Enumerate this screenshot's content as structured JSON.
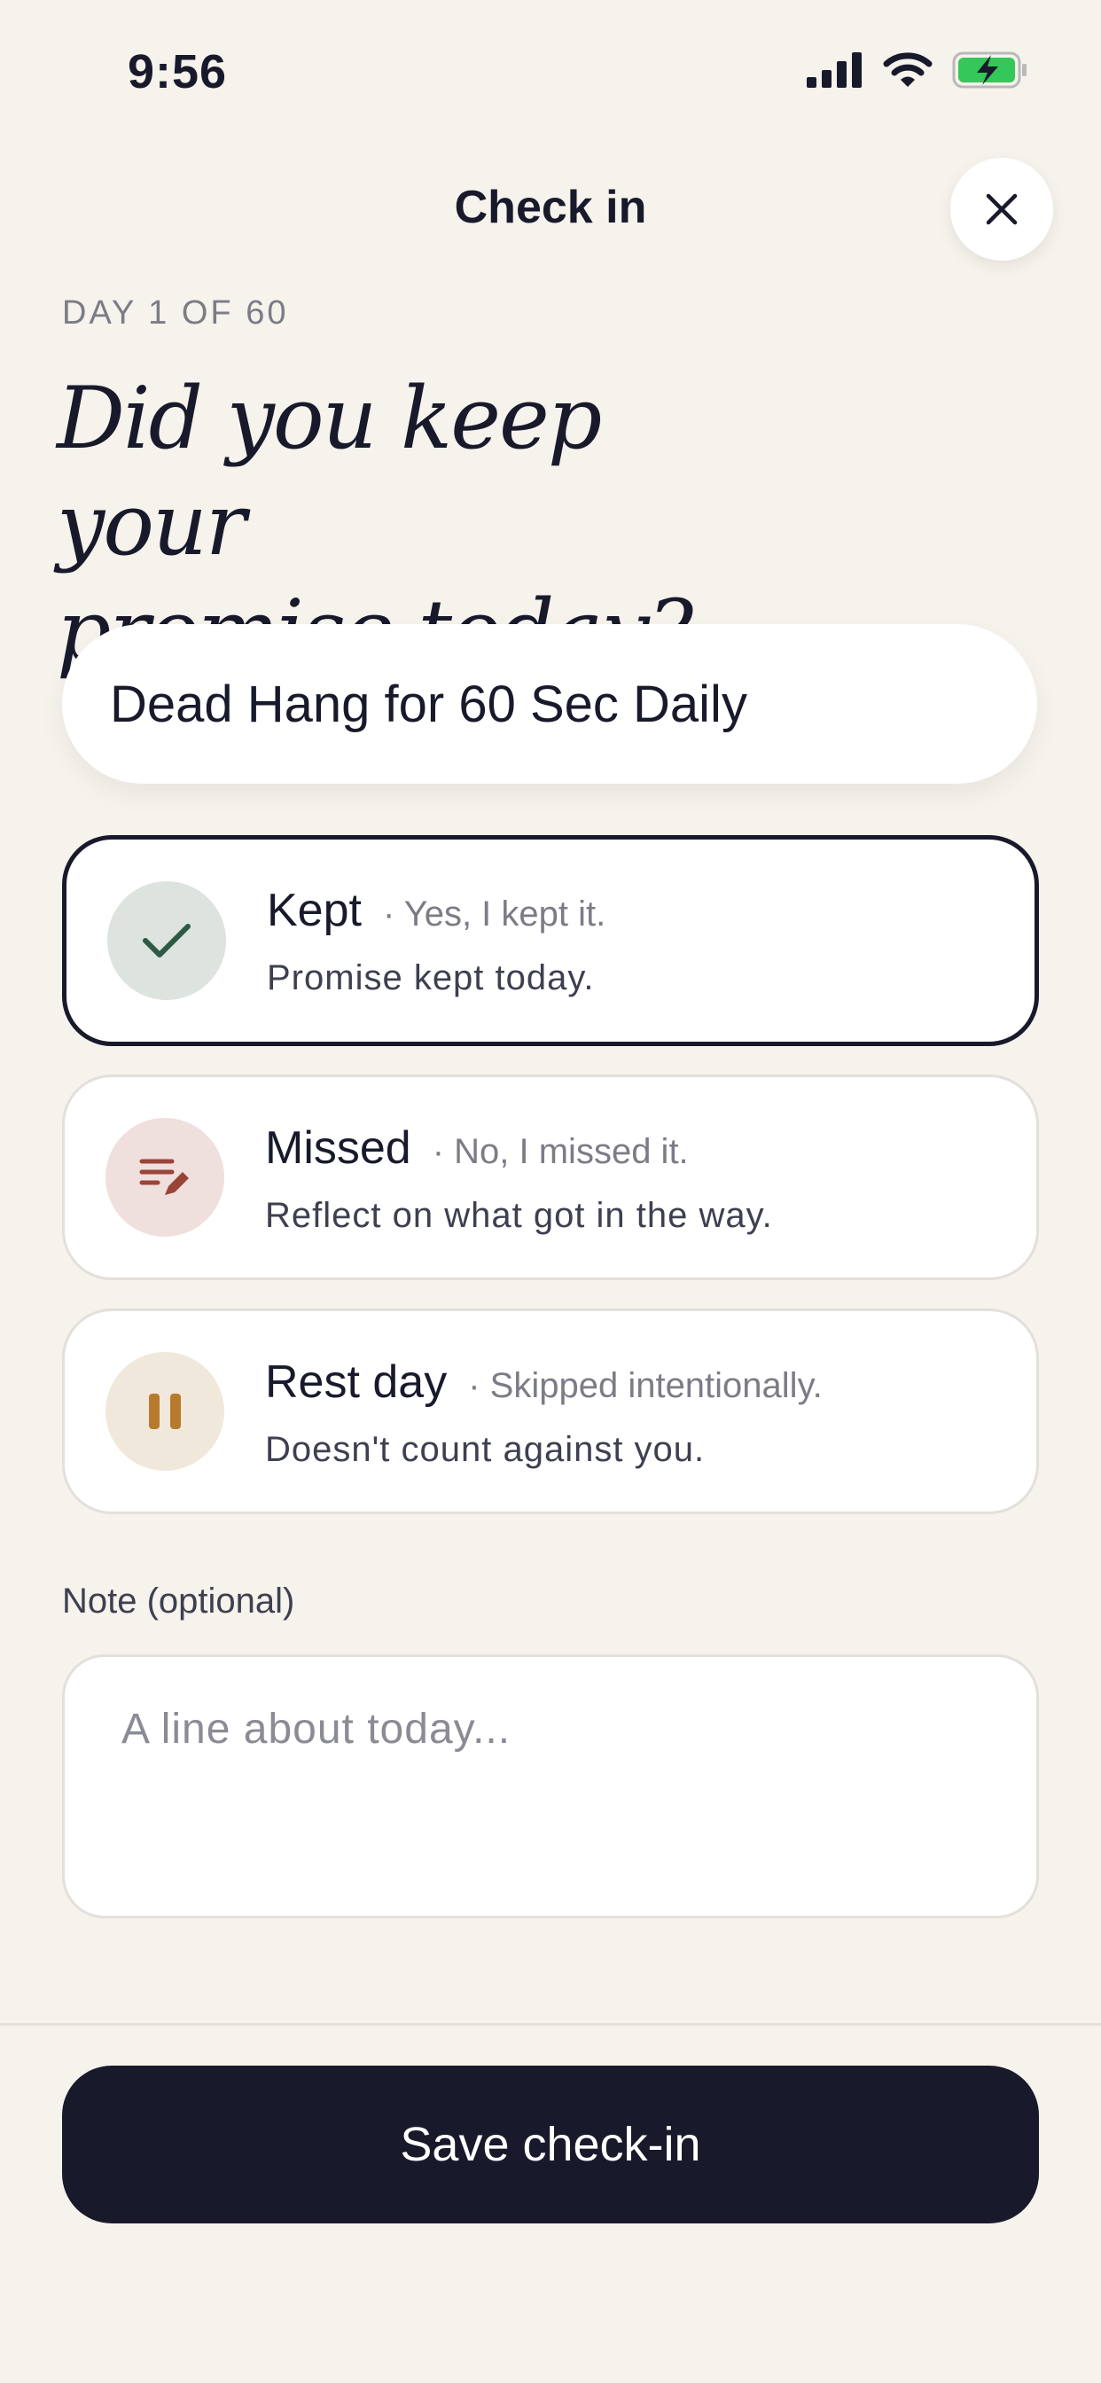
{
  "status_bar": {
    "time": "9:56"
  },
  "header": {
    "title": "Check in"
  },
  "progress": {
    "day_label": "DAY 1 OF 60"
  },
  "question": {
    "line1": "Did you keep your",
    "line2": "promise today?"
  },
  "promise": {
    "name": "Dead Hang for 60 Sec Daily"
  },
  "options": [
    {
      "title": "Kept",
      "subtitle": "· Yes, I kept it.",
      "description": "Promise kept today.",
      "icon": "check-icon",
      "selected": true,
      "circle_color": "#dde3df",
      "icon_color": "#2e5a44"
    },
    {
      "title": "Missed",
      "subtitle": "· No, I missed it.",
      "description": "Reflect on what got in the way.",
      "icon": "note-pencil-icon",
      "selected": false,
      "circle_color": "#efdfdd",
      "icon_color": "#9a4438"
    },
    {
      "title": "Rest day",
      "subtitle": "· Skipped intentionally.",
      "description": "Doesn't count against you.",
      "icon": "pause-icon",
      "selected": false,
      "circle_color": "#f1e8dc",
      "icon_color": "#b87a2d"
    }
  ],
  "note": {
    "label": "Note (optional)",
    "placeholder": "A line about today..."
  },
  "save_button": {
    "label": "Save check-in"
  },
  "colors": {
    "background": "#f6f2ec",
    "ink": "#181a2c",
    "battery": "#34c759"
  }
}
